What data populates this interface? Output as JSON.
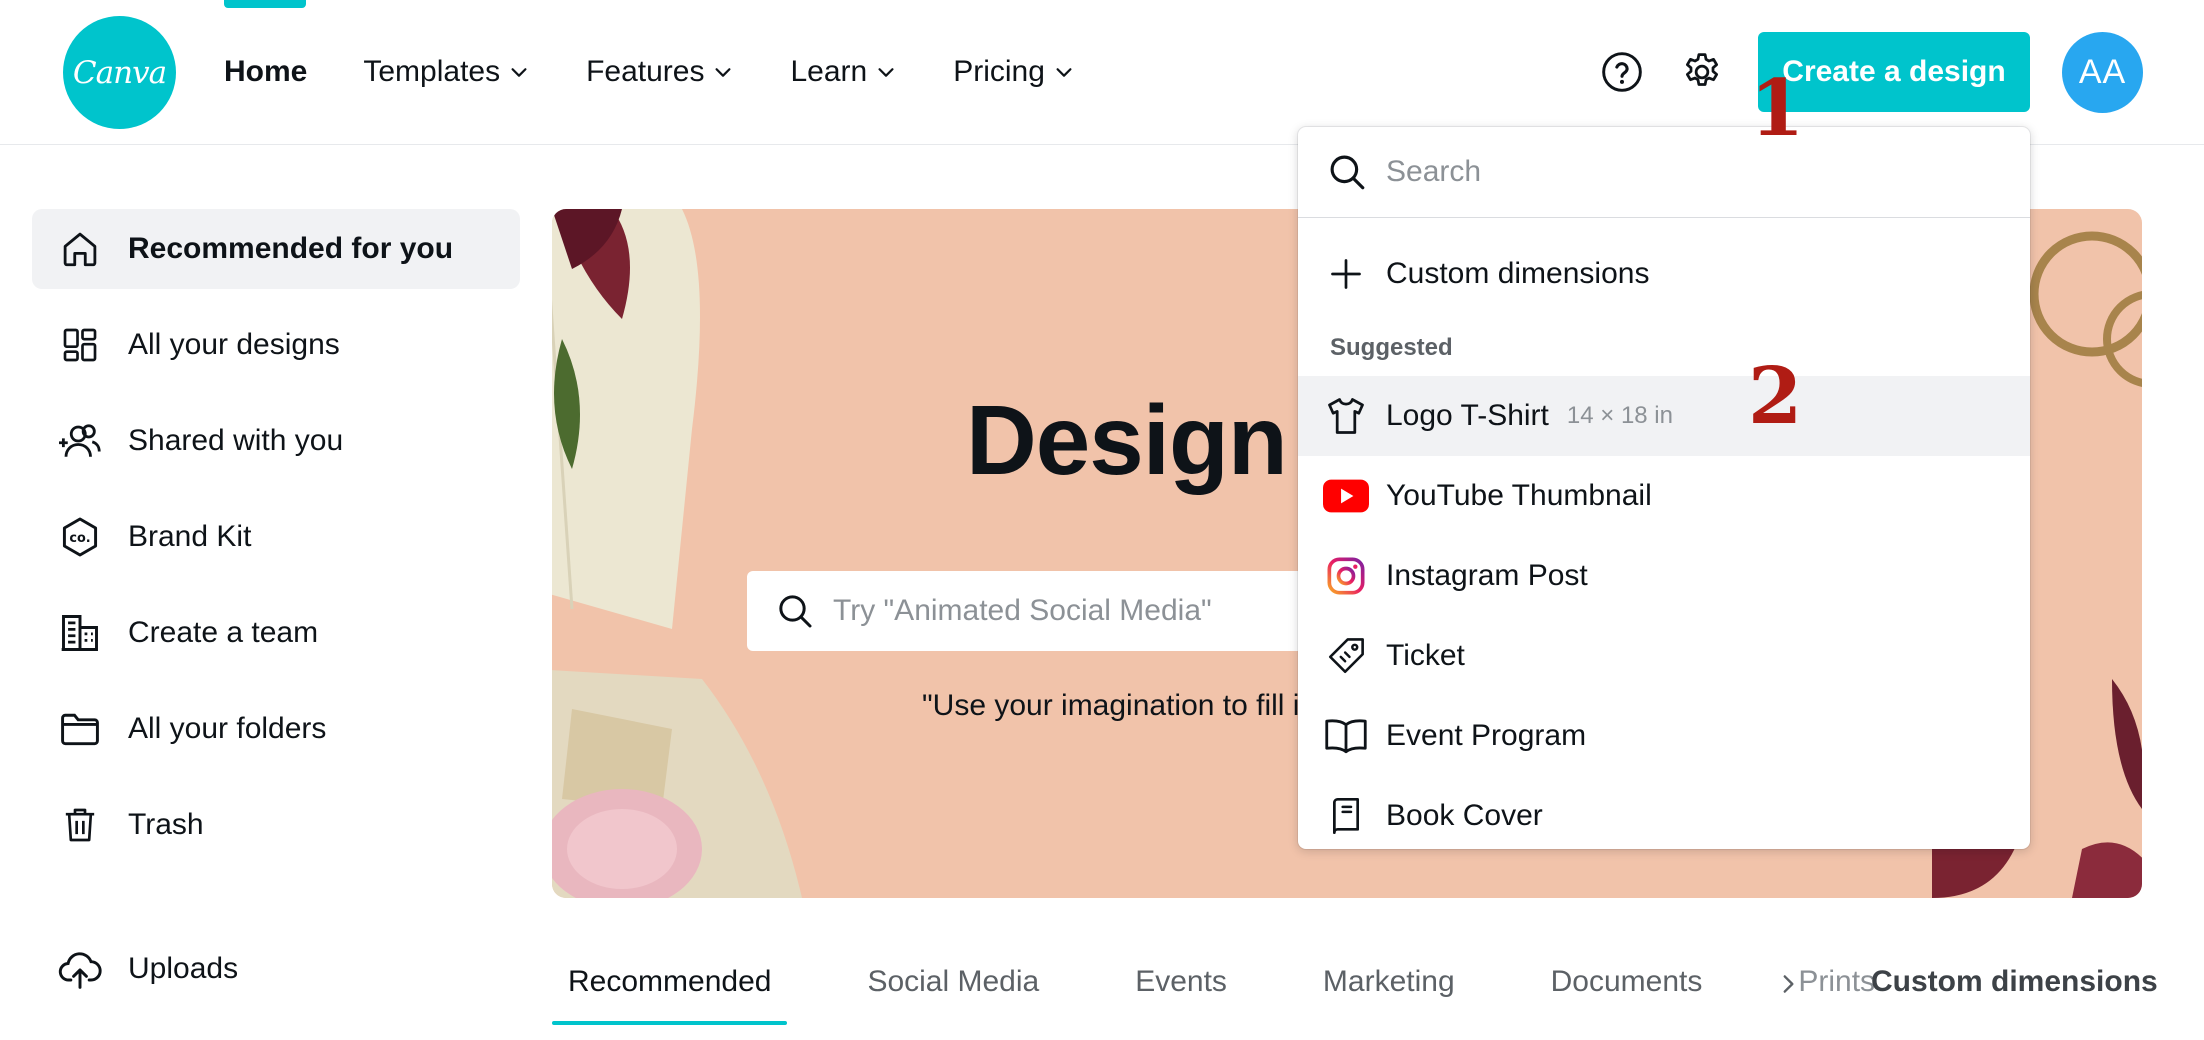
{
  "header": {
    "logo_text": "Canva",
    "nav": [
      {
        "label": "Home",
        "has_dropdown": false
      },
      {
        "label": "Templates",
        "has_dropdown": true
      },
      {
        "label": "Features",
        "has_dropdown": true
      },
      {
        "label": "Learn",
        "has_dropdown": true
      },
      {
        "label": "Pricing",
        "has_dropdown": true
      }
    ],
    "help_icon": "help-circle-icon",
    "settings_icon": "gear-icon",
    "create_button": "Create a design",
    "avatar_initials": "AA",
    "accent_color": "#00c4cc",
    "avatar_color": "#28a7f0"
  },
  "sidebar": {
    "items": [
      {
        "label": "Recommended for you",
        "icon": "home-icon",
        "active": true
      },
      {
        "label": "All your designs",
        "icon": "grid-icon"
      },
      {
        "label": "Shared with you",
        "icon": "users-icon"
      },
      {
        "label": "Brand Kit",
        "icon": "brand-kit-icon"
      },
      {
        "label": "Create a team",
        "icon": "building-icon"
      },
      {
        "label": "All your folders",
        "icon": "folder-icon"
      },
      {
        "label": "Trash",
        "icon": "trash-icon"
      },
      {
        "label": "Uploads",
        "icon": "upload-cloud-icon"
      }
    ]
  },
  "hero": {
    "title": "Design",
    "search_placeholder": "Try \"Animated Social Media\"",
    "quote": "\"Use your imagination to fill i",
    "background_color": "#f1c3aa"
  },
  "dropdown": {
    "search_placeholder": "Search",
    "custom_label": "Custom dimensions",
    "section_label": "Suggested",
    "items": [
      {
        "label": "Logo T-Shirt",
        "dimensions": "14 × 18 in",
        "icon": "tshirt-icon",
        "highlighted": true
      },
      {
        "label": "YouTube Thumbnail",
        "icon": "youtube-icon"
      },
      {
        "label": "Instagram Post",
        "icon": "instagram-icon"
      },
      {
        "label": "Ticket",
        "icon": "ticket-icon"
      },
      {
        "label": "Event Program",
        "icon": "book-open-icon"
      },
      {
        "label": "Book Cover",
        "icon": "book-cover-icon"
      }
    ]
  },
  "markers": {
    "step1": "1",
    "step2": "2",
    "color": "#b01c14"
  },
  "tabs": {
    "items": [
      "Recommended",
      "Social Media",
      "Events",
      "Marketing",
      "Documents",
      "Prints"
    ],
    "active_index": 0,
    "more_icon": "chevron-right-icon",
    "custom_label": "Custom dimensions"
  }
}
